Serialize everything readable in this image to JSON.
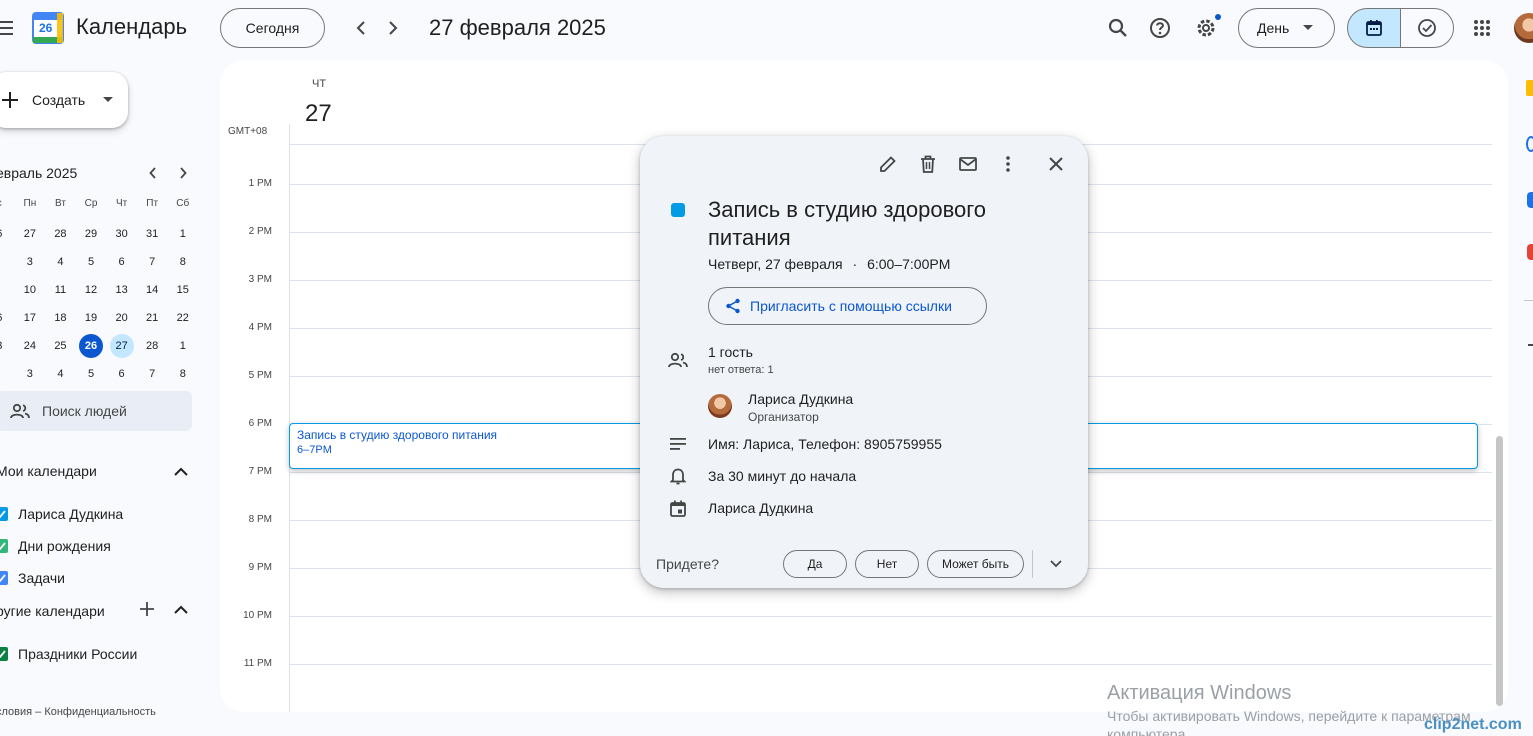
{
  "app": {
    "title": "Календарь",
    "logo_day": "26"
  },
  "header": {
    "today_label": "Сегодня",
    "date_title": "27 февраля 2025",
    "view_label": "День"
  },
  "sidebar": {
    "create_label": "Создать",
    "mini_month": "евраль 2025",
    "weekdays": [
      "с",
      "Пн",
      "Вт",
      "Ср",
      "Чт",
      "Пт",
      "Сб"
    ],
    "weeks": [
      [
        "6",
        "27",
        "28",
        "29",
        "30",
        "31",
        "1"
      ],
      [
        "",
        "3",
        "4",
        "5",
        "6",
        "7",
        "8"
      ],
      [
        "",
        "10",
        "11",
        "12",
        "13",
        "14",
        "15"
      ],
      [
        "6",
        "17",
        "18",
        "19",
        "20",
        "21",
        "22"
      ],
      [
        "3",
        "24",
        "25",
        "26",
        "27",
        "28",
        "1"
      ],
      [
        "",
        "3",
        "4",
        "5",
        "6",
        "7",
        "8"
      ]
    ],
    "people_search": "Поиск людей",
    "my_calendars_title": "Мои календари",
    "my_calendars": [
      {
        "label": "Лариса Дудкина",
        "color": "#039be5"
      },
      {
        "label": "Дни рождения",
        "color": "#33b679"
      },
      {
        "label": "Задачи",
        "color": "#4285f4"
      }
    ],
    "other_calendars_title": "ругие календари",
    "other_calendars": [
      {
        "label": "Праздники России",
        "color": "#0b8043"
      }
    ],
    "footer": "словия – Конфиденциальность"
  },
  "day_view": {
    "day_name": "ЧТ",
    "day_number": "27",
    "timezone": "GMT+08",
    "hours": [
      "1 PM",
      "2 PM",
      "3 PM",
      "4 PM",
      "5 PM",
      "6 PM",
      "7 PM",
      "8 PM",
      "9 PM",
      "10 PM",
      "11 PM"
    ],
    "event": {
      "title": "Запись в студию здорового питания",
      "time": "6–7PM",
      "color": "#039be5"
    }
  },
  "popup": {
    "title": "Запись в студию здорового питания",
    "when_date": "Четверг, 27 февраля",
    "when_sep": "·",
    "when_time": "6:00–7:00PM",
    "invite_label": "Пригласить с помощью ссылки",
    "guests_count": "1 гость",
    "guests_status": "нет ответа: 1",
    "organizer_name": "Лариса Дудкина",
    "organizer_role": "Организатор",
    "description": "Имя: Лариса, Телефон: 8905759955",
    "reminder": "За 30 минут до начала",
    "calendar_name": "Лариса Дудкина",
    "rsvp_question": "Придете?",
    "rsvp_yes": "Да",
    "rsvp_no": "Нет",
    "rsvp_maybe": "Может быть"
  },
  "watermark": {
    "title": "Активация Windows",
    "line1": "Чтобы активировать Windows, перейдите к параметрам",
    "line2": "компьютера.",
    "brand": "clip2net.com"
  }
}
